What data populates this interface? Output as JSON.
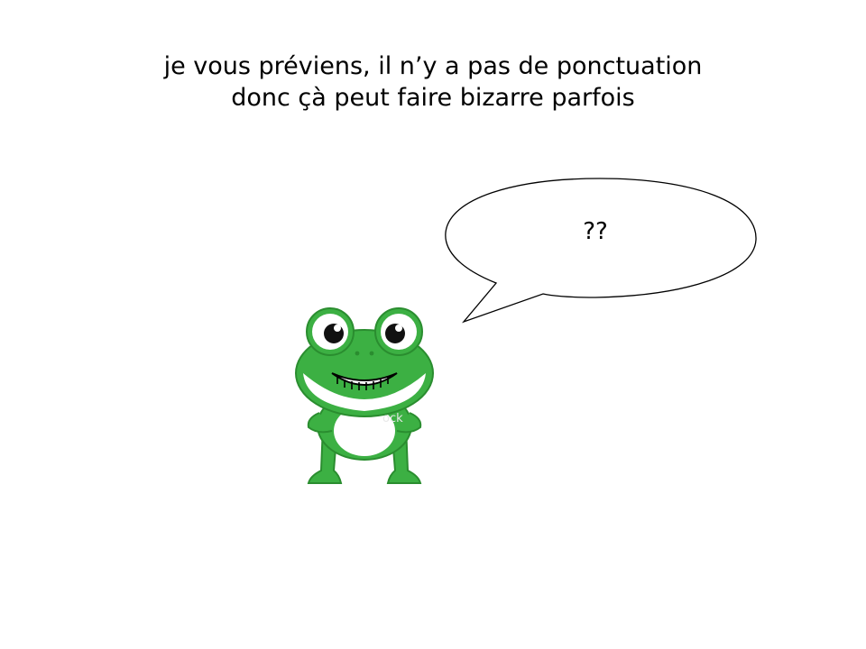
{
  "slide": {
    "caption_lines": [
      "je vous préviens, il n’y a pas de ponctuation",
      "donc çà peut faire bizarre parfois"
    ],
    "speech_bubble": {
      "text": "??"
    },
    "illustration": {
      "icon": "cartoon-frog-icon",
      "watermark_text": "ock"
    },
    "colors": {
      "frog_green": "#3cb043",
      "frog_dark_green": "#2a8d2f",
      "bubble_fill": "#ffffff",
      "outline": "#000000"
    }
  }
}
